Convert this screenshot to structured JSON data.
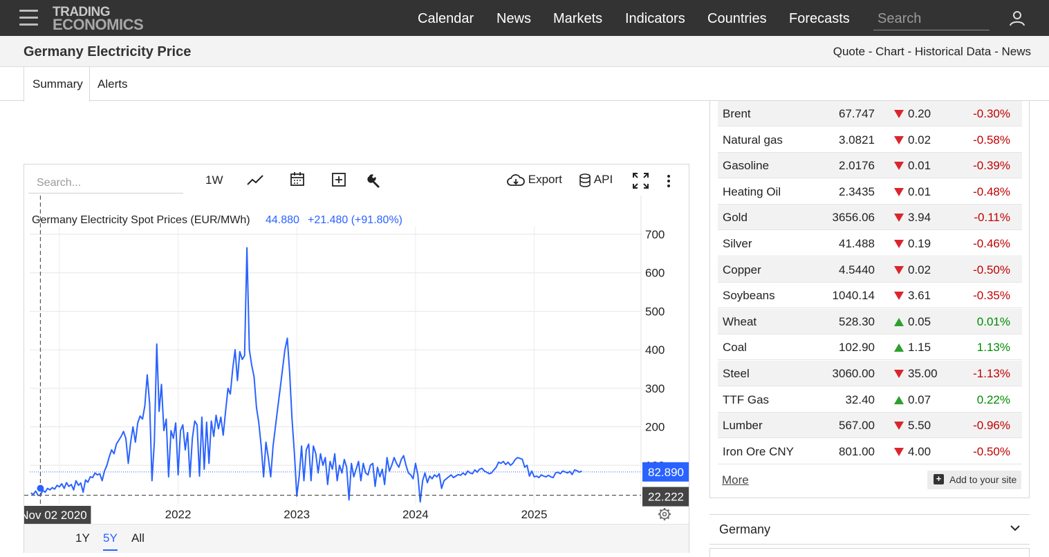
{
  "nav": {
    "logo_line1": "TRADING",
    "logo_line2": "ECONOMICS",
    "links": [
      "Calendar",
      "News",
      "Markets",
      "Indicators",
      "Countries",
      "Forecasts"
    ],
    "search_placeholder": "Search"
  },
  "header": {
    "title": "Germany Electricity Price",
    "links": [
      "Quote",
      "Chart",
      "Historical Data",
      "News"
    ],
    "separator": " - "
  },
  "tabs": [
    "Summary",
    "Alerts"
  ],
  "chart_toolbar": {
    "search_placeholder": "Search...",
    "interval": "1W",
    "export_label": "Export",
    "api_label": "API"
  },
  "chart_data": {
    "type": "line",
    "series_title": "Germany Electricity Spot Prices (EUR/MWh)",
    "last_value": "44.880",
    "change": "+21.480 (+91.80%)",
    "y_ticks": [
      100,
      200,
      300,
      400,
      500,
      600,
      700
    ],
    "ylim": [
      0,
      730
    ],
    "x_ticks": [
      {
        "label": "2022",
        "t": 2022.0
      },
      {
        "label": "2023",
        "t": 2023.0
      },
      {
        "label": "2024",
        "t": 2024.0
      },
      {
        "label": "2025",
        "t": 2025.0
      }
    ],
    "xlim": [
      2020.75,
      2025.9
    ],
    "crosshair_label": "Nov 02 2020",
    "crosshair_t": 2020.84,
    "price_label_current": "82.890",
    "price_current": 82.89,
    "price_label_cross": "22.222",
    "price_cross": 22.222,
    "color": "#2962ff",
    "points": [
      [
        2020.76,
        28
      ],
      [
        2020.78,
        24
      ],
      [
        2020.8,
        33
      ],
      [
        2020.82,
        22
      ],
      [
        2020.84,
        22
      ],
      [
        2020.86,
        35
      ],
      [
        2020.88,
        30
      ],
      [
        2020.9,
        40
      ],
      [
        2020.92,
        36
      ],
      [
        2020.94,
        42
      ],
      [
        2020.96,
        38
      ],
      [
        2020.98,
        48
      ],
      [
        2021.0,
        44
      ],
      [
        2021.02,
        52
      ],
      [
        2021.04,
        40
      ],
      [
        2021.06,
        55
      ],
      [
        2021.08,
        45
      ],
      [
        2021.1,
        50
      ],
      [
        2021.12,
        36
      ],
      [
        2021.14,
        60
      ],
      [
        2021.16,
        48
      ],
      [
        2021.18,
        54
      ],
      [
        2021.2,
        30
      ],
      [
        2021.22,
        62
      ],
      [
        2021.24,
        56
      ],
      [
        2021.26,
        70
      ],
      [
        2021.28,
        68
      ],
      [
        2021.3,
        80
      ],
      [
        2021.32,
        75
      ],
      [
        2021.34,
        78
      ],
      [
        2021.36,
        60
      ],
      [
        2021.38,
        85
      ],
      [
        2021.4,
        100
      ],
      [
        2021.42,
        122
      ],
      [
        2021.44,
        140
      ],
      [
        2021.46,
        130
      ],
      [
        2021.48,
        155
      ],
      [
        2021.5,
        165
      ],
      [
        2021.52,
        175
      ],
      [
        2021.54,
        188
      ],
      [
        2021.56,
        170
      ],
      [
        2021.58,
        105
      ],
      [
        2021.6,
        160
      ],
      [
        2021.62,
        200
      ],
      [
        2021.64,
        160
      ],
      [
        2021.66,
        210
      ],
      [
        2021.68,
        228
      ],
      [
        2021.7,
        220
      ],
      [
        2021.72,
        255
      ],
      [
        2021.74,
        335
      ],
      [
        2021.76,
        260
      ],
      [
        2021.78,
        60
      ],
      [
        2021.8,
        160
      ],
      [
        2021.82,
        415
      ],
      [
        2021.84,
        240
      ],
      [
        2021.86,
        310
      ],
      [
        2021.88,
        190
      ],
      [
        2021.9,
        220
      ],
      [
        2021.92,
        70
      ],
      [
        2021.94,
        190
      ],
      [
        2021.96,
        170
      ],
      [
        2021.98,
        210
      ],
      [
        2022.0,
        75
      ],
      [
        2022.02,
        190
      ],
      [
        2022.04,
        205
      ],
      [
        2022.06,
        140
      ],
      [
        2022.08,
        185
      ],
      [
        2022.1,
        70
      ],
      [
        2022.12,
        170
      ],
      [
        2022.14,
        215
      ],
      [
        2022.16,
        205
      ],
      [
        2022.18,
        72
      ],
      [
        2022.2,
        225
      ],
      [
        2022.22,
        90
      ],
      [
        2022.24,
        212
      ],
      [
        2022.26,
        105
      ],
      [
        2022.28,
        215
      ],
      [
        2022.3,
        175
      ],
      [
        2022.32,
        230
      ],
      [
        2022.34,
        195
      ],
      [
        2022.36,
        225
      ],
      [
        2022.38,
        178
      ],
      [
        2022.4,
        240
      ],
      [
        2022.42,
        300
      ],
      [
        2022.44,
        285
      ],
      [
        2022.46,
        350
      ],
      [
        2022.48,
        400
      ],
      [
        2022.5,
        320
      ],
      [
        2022.52,
        395
      ],
      [
        2022.54,
        375
      ],
      [
        2022.56,
        385
      ],
      [
        2022.58,
        665
      ],
      [
        2022.6,
        400
      ],
      [
        2022.62,
        360
      ],
      [
        2022.64,
        330
      ],
      [
        2022.66,
        250
      ],
      [
        2022.68,
        210
      ],
      [
        2022.7,
        150
      ],
      [
        2022.72,
        70
      ],
      [
        2022.74,
        160
      ],
      [
        2022.76,
        120
      ],
      [
        2022.78,
        70
      ],
      [
        2022.8,
        150
      ],
      [
        2022.82,
        200
      ],
      [
        2022.84,
        250
      ],
      [
        2022.86,
        300
      ],
      [
        2022.88,
        350
      ],
      [
        2022.9,
        400
      ],
      [
        2022.92,
        430
      ],
      [
        2022.94,
        340
      ],
      [
        2022.96,
        220
      ],
      [
        2022.98,
        130
      ],
      [
        2023.0,
        20
      ],
      [
        2023.02,
        70
      ],
      [
        2023.04,
        150
      ],
      [
        2023.06,
        60
      ],
      [
        2023.08,
        140
      ],
      [
        2023.1,
        155
      ],
      [
        2023.12,
        60
      ],
      [
        2023.14,
        150
      ],
      [
        2023.16,
        130
      ],
      [
        2023.18,
        80
      ],
      [
        2023.2,
        130
      ],
      [
        2023.22,
        100
      ],
      [
        2023.24,
        120
      ],
      [
        2023.26,
        50
      ],
      [
        2023.28,
        110
      ],
      [
        2023.3,
        90
      ],
      [
        2023.32,
        130
      ],
      [
        2023.34,
        60
      ],
      [
        2023.36,
        100
      ],
      [
        2023.38,
        80
      ],
      [
        2023.4,
        115
      ],
      [
        2023.42,
        95
      ],
      [
        2023.44,
        10
      ],
      [
        2023.46,
        105
      ],
      [
        2023.48,
        70
      ],
      [
        2023.5,
        90
      ],
      [
        2023.52,
        110
      ],
      [
        2023.54,
        60
      ],
      [
        2023.56,
        105
      ],
      [
        2023.58,
        80
      ],
      [
        2023.6,
        75
      ],
      [
        2023.62,
        100
      ],
      [
        2023.64,
        105
      ],
      [
        2023.66,
        45
      ],
      [
        2023.68,
        95
      ],
      [
        2023.7,
        70
      ],
      [
        2023.72,
        90
      ],
      [
        2023.74,
        50
      ],
      [
        2023.76,
        120
      ],
      [
        2023.78,
        85
      ],
      [
        2023.8,
        100
      ],
      [
        2023.82,
        120
      ],
      [
        2023.84,
        105
      ],
      [
        2023.86,
        95
      ],
      [
        2023.88,
        115
      ],
      [
        2023.9,
        125
      ],
      [
        2023.92,
        100
      ],
      [
        2023.94,
        80
      ],
      [
        2023.96,
        75
      ],
      [
        2023.98,
        65
      ],
      [
        2024.0,
        105
      ],
      [
        2024.02,
        75
      ],
      [
        2024.04,
        5
      ],
      [
        2024.06,
        60
      ],
      [
        2024.08,
        80
      ],
      [
        2024.1,
        55
      ],
      [
        2024.12,
        72
      ],
      [
        2024.14,
        65
      ],
      [
        2024.16,
        75
      ],
      [
        2024.18,
        70
      ],
      [
        2024.2,
        78
      ],
      [
        2024.22,
        40
      ],
      [
        2024.24,
        60
      ],
      [
        2024.26,
        65
      ],
      [
        2024.28,
        70
      ],
      [
        2024.3,
        75
      ],
      [
        2024.32,
        68
      ],
      [
        2024.34,
        72
      ],
      [
        2024.36,
        76
      ],
      [
        2024.38,
        74
      ],
      [
        2024.4,
        80
      ],
      [
        2024.42,
        75
      ],
      [
        2024.44,
        85
      ],
      [
        2024.46,
        80
      ],
      [
        2024.48,
        78
      ],
      [
        2024.5,
        88
      ],
      [
        2024.52,
        82
      ],
      [
        2024.54,
        90
      ],
      [
        2024.56,
        92
      ],
      [
        2024.58,
        85
      ],
      [
        2024.6,
        82
      ],
      [
        2024.62,
        78
      ],
      [
        2024.64,
        80
      ],
      [
        2024.66,
        88
      ],
      [
        2024.68,
        95
      ],
      [
        2024.7,
        108
      ],
      [
        2024.72,
        105
      ],
      [
        2024.74,
        110
      ],
      [
        2024.76,
        102
      ],
      [
        2024.78,
        108
      ],
      [
        2024.8,
        100
      ],
      [
        2024.82,
        105
      ],
      [
        2024.84,
        115
      ],
      [
        2024.86,
        120
      ],
      [
        2024.88,
        118
      ],
      [
        2024.9,
        116
      ],
      [
        2024.92,
        95
      ],
      [
        2024.94,
        100
      ],
      [
        2024.96,
        72
      ],
      [
        2024.98,
        85
      ],
      [
        2025.0,
        70
      ],
      [
        2025.02,
        72
      ],
      [
        2025.04,
        68
      ],
      [
        2025.06,
        75
      ],
      [
        2025.08,
        72
      ],
      [
        2025.1,
        70
      ],
      [
        2025.12,
        74
      ],
      [
        2025.14,
        70
      ],
      [
        2025.16,
        68
      ],
      [
        2025.18,
        80
      ],
      [
        2025.2,
        82
      ],
      [
        2025.22,
        78
      ],
      [
        2025.24,
        85
      ],
      [
        2025.26,
        83
      ],
      [
        2025.28,
        80
      ],
      [
        2025.3,
        84
      ],
      [
        2025.32,
        76
      ],
      [
        2025.34,
        88
      ],
      [
        2025.36,
        86
      ],
      [
        2025.38,
        82
      ],
      [
        2025.4,
        85
      ]
    ]
  },
  "range_buttons": [
    "1Y",
    "5Y",
    "All"
  ],
  "range_active": "5Y",
  "commodities": [
    {
      "name": "Brent",
      "price": "67.747",
      "dir": "down",
      "change": "0.20",
      "pct": "-0.30%"
    },
    {
      "name": "Natural gas",
      "price": "3.0821",
      "dir": "down",
      "change": "0.02",
      "pct": "-0.58%"
    },
    {
      "name": "Gasoline",
      "price": "2.0176",
      "dir": "down",
      "change": "0.01",
      "pct": "-0.39%"
    },
    {
      "name": "Heating Oil",
      "price": "2.3435",
      "dir": "down",
      "change": "0.01",
      "pct": "-0.48%"
    },
    {
      "name": "Gold",
      "price": "3656.06",
      "dir": "down",
      "change": "3.94",
      "pct": "-0.11%"
    },
    {
      "name": "Silver",
      "price": "41.488",
      "dir": "down",
      "change": "0.19",
      "pct": "-0.46%"
    },
    {
      "name": "Copper",
      "price": "4.5440",
      "dir": "down",
      "change": "0.02",
      "pct": "-0.50%"
    },
    {
      "name": "Soybeans",
      "price": "1040.14",
      "dir": "down",
      "change": "3.61",
      "pct": "-0.35%"
    },
    {
      "name": "Wheat",
      "price": "528.30",
      "dir": "up",
      "change": "0.05",
      "pct": "0.01%"
    },
    {
      "name": "Coal",
      "price": "102.90",
      "dir": "up",
      "change": "1.15",
      "pct": "1.13%"
    },
    {
      "name": "Steel",
      "price": "3060.00",
      "dir": "down",
      "change": "35.00",
      "pct": "-1.13%"
    },
    {
      "name": "TTF Gas",
      "price": "32.40",
      "dir": "up",
      "change": "0.07",
      "pct": "0.22%"
    },
    {
      "name": "Lumber",
      "price": "567.00",
      "dir": "down",
      "change": "5.50",
      "pct": "-0.96%"
    },
    {
      "name": "Iron Ore CNY",
      "price": "801.00",
      "dir": "down",
      "change": "4.00",
      "pct": "-0.50%"
    }
  ],
  "commodities_more": "More",
  "add_to_site": "Add to your site",
  "germany_panel": "Germany",
  "colors": {
    "up": "#2e9e2e",
    "down": "#d9262c",
    "accent": "#2962ff"
  }
}
